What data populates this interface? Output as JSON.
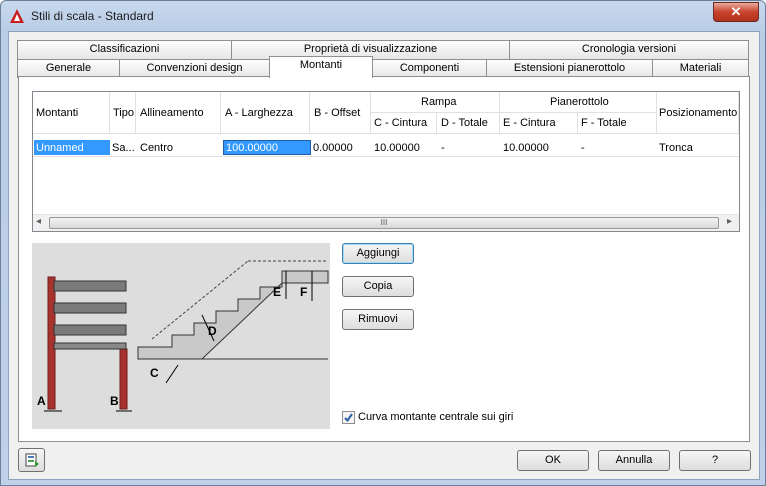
{
  "window": {
    "title": "Stili di scala - Standard",
    "close_glyph": "✕"
  },
  "tabs_row1": [
    "Classificazioni",
    "Proprietà di visualizzazione",
    "Cronologia versioni"
  ],
  "tabs_row2": [
    "Generale",
    "Convenzioni design",
    "Montanti",
    "Componenti",
    "Estensioni pianerottolo",
    "Materiali"
  ],
  "active_tab": "Montanti",
  "grid": {
    "headers": {
      "montanti": "Montanti",
      "tipo": "Tipo",
      "allineamento": "Allineamento",
      "a": "A - Larghezza",
      "b": "B - Offset",
      "rampa": "Rampa",
      "c": "C - Cintura",
      "d": "D - Totale",
      "pianerottolo": "Pianerottolo",
      "e": "E - Cintura",
      "f": "F - Totale",
      "posizionamento": "Posizionamento"
    },
    "row": {
      "montanti": "Unnamed",
      "tipo": "Sa...",
      "allineamento": "Centro",
      "a": "100.00000",
      "b": "0.00000",
      "c": "10.00000",
      "d": "-",
      "e": "10.00000",
      "f": "-",
      "posizionamento": "Tronca"
    },
    "scroll_thumb_glyph": "III",
    "scroll_left_glyph": "◂",
    "scroll_right_glyph": "▸"
  },
  "buttons": {
    "add": "Aggiungi",
    "copy": "Copia",
    "remove": "Rimuovi"
  },
  "illustration_labels": {
    "a": "A",
    "b": "B",
    "c": "C",
    "d": "D",
    "e": "E",
    "f": "F"
  },
  "checkbox": {
    "label": "Curva montante centrale sui giri",
    "checked": true
  },
  "footer": {
    "ok": "OK",
    "cancel": "Annulla",
    "help": "?"
  },
  "colors": {
    "selection": "#3399ff",
    "autocad_red": "#c81e1e"
  }
}
